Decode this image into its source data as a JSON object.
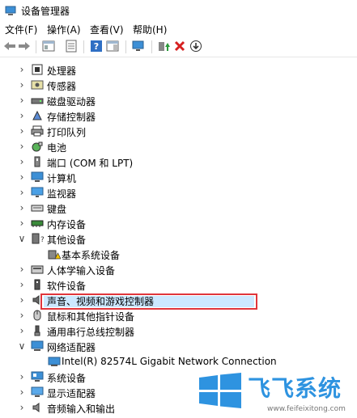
{
  "window": {
    "title": "设备管理器"
  },
  "menu": [
    {
      "label": "文件(F)"
    },
    {
      "label": "操作(A)"
    },
    {
      "label": "查看(V)"
    },
    {
      "label": "帮助(H)"
    }
  ],
  "toolbar": {
    "icons": [
      "back-arrow-icon",
      "forward-arrow-icon",
      "show-hide-tree-icon",
      "properties-icon",
      "help-icon",
      "action-pane-icon",
      "scan-hardware-icon",
      "update-driver-icon",
      "uninstall-x-icon",
      "disable-device-icon"
    ],
    "colors": {
      "uninstall": "#d62020",
      "update": "#2a9a3a"
    }
  },
  "tree": {
    "categories": [
      {
        "label": "处理器",
        "expanded": false,
        "icon": "processor-icon"
      },
      {
        "label": "传感器",
        "expanded": false,
        "icon": "sensor-icon"
      },
      {
        "label": "磁盘驱动器",
        "expanded": false,
        "icon": "disk-drive-icon"
      },
      {
        "label": "存储控制器",
        "expanded": false,
        "icon": "storage-controller-icon"
      },
      {
        "label": "打印队列",
        "expanded": false,
        "icon": "printer-icon"
      },
      {
        "label": "电池",
        "expanded": false,
        "icon": "battery-icon"
      },
      {
        "label": "端口 (COM 和 LPT)",
        "expanded": false,
        "icon": "port-icon"
      },
      {
        "label": "计算机",
        "expanded": false,
        "icon": "computer-icon"
      },
      {
        "label": "监视器",
        "expanded": false,
        "icon": "monitor-icon"
      },
      {
        "label": "键盘",
        "expanded": false,
        "icon": "keyboard-icon"
      },
      {
        "label": "内存设备",
        "expanded": false,
        "icon": "memory-icon"
      },
      {
        "label": "其他设备",
        "expanded": true,
        "icon": "other-devices-icon",
        "children": [
          {
            "label": "基本系统设备",
            "icon": "warning-device-icon"
          }
        ]
      },
      {
        "label": "人体学输入设备",
        "expanded": false,
        "icon": "hid-icon"
      },
      {
        "label": "软件设备",
        "expanded": false,
        "icon": "software-device-icon"
      },
      {
        "label": "声音、视频和游戏控制器",
        "expanded": false,
        "icon": "sound-icon"
      },
      {
        "label": "鼠标和其他指针设备",
        "expanded": false,
        "icon": "mouse-icon"
      },
      {
        "label": "通用串行总线控制器",
        "expanded": false,
        "icon": "usb-icon"
      },
      {
        "label": "网络适配器",
        "expanded": true,
        "icon": "network-adapter-icon",
        "children": [
          {
            "label": "Intel(R) 82574L Gigabit Network Connection",
            "icon": "network-card-icon",
            "selected": true
          }
        ]
      },
      {
        "label": "系统设备",
        "expanded": false,
        "icon": "system-device-icon"
      },
      {
        "label": "显示适配器",
        "expanded": false,
        "icon": "display-adapter-icon"
      },
      {
        "label": "音频输入和输出",
        "expanded": false,
        "icon": "audio-io-icon"
      }
    ]
  },
  "watermark": {
    "brand": "飞飞系统",
    "site": "www.feifeixitong.com",
    "color": "#2e93e0"
  }
}
